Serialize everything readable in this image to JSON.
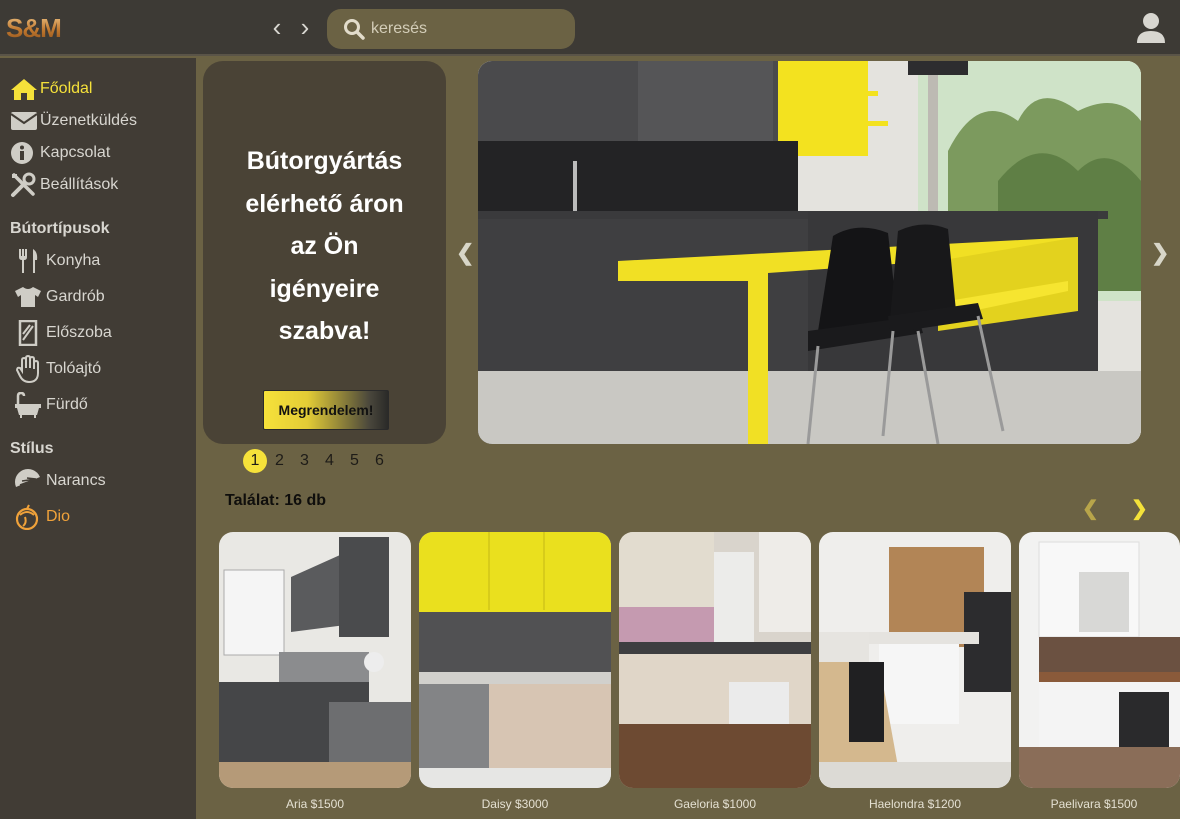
{
  "header": {
    "logo": "S&M",
    "search_placeholder": "keresés"
  },
  "sidebar": {
    "nav": [
      {
        "label": "Főoldal",
        "icon": "home-icon",
        "active": true
      },
      {
        "label": "Üzenetküldés",
        "icon": "envelope-icon"
      },
      {
        "label": "Kapcsolat",
        "icon": "info-icon"
      },
      {
        "label": "Beállítások",
        "icon": "tools-icon"
      }
    ],
    "section_types": "Bútortípusok",
    "types": [
      {
        "label": "Konyha",
        "icon": "utensils-icon"
      },
      {
        "label": "Gardrób",
        "icon": "tshirt-icon"
      },
      {
        "label": "Előszoba",
        "icon": "door-icon"
      },
      {
        "label": "Tolóajtó",
        "icon": "hand-icon"
      },
      {
        "label": "Fürdő",
        "icon": "bath-icon"
      }
    ],
    "section_style": "Stílus",
    "styles": [
      {
        "label": "Narancs",
        "icon": "orange-slice-icon"
      },
      {
        "label": "Dio",
        "icon": "walnut-icon",
        "active": true
      }
    ]
  },
  "hero": {
    "text": "Bútorgyártás\nelérhető áron\naz Ön\nigényeire\nszabva!",
    "button": "Megrendelem!"
  },
  "pagination": [
    "1",
    "2",
    "3",
    "4",
    "5",
    "6"
  ],
  "pagination_active": 1,
  "results_label": "Találat: 16 db",
  "products": [
    {
      "caption": "Aria $1500"
    },
    {
      "caption": "Daisy $3000"
    },
    {
      "caption": "Gaeloria $1000"
    },
    {
      "caption": "Haelondra $1200"
    },
    {
      "caption": "Paelivara $1500"
    }
  ],
  "colors": {
    "accent_yellow": "#f6e23a",
    "topbar": "#3d3a35",
    "sidebar": "#413c35",
    "content_bg": "#6b6244",
    "walnut_accent": "#f0a23a"
  }
}
